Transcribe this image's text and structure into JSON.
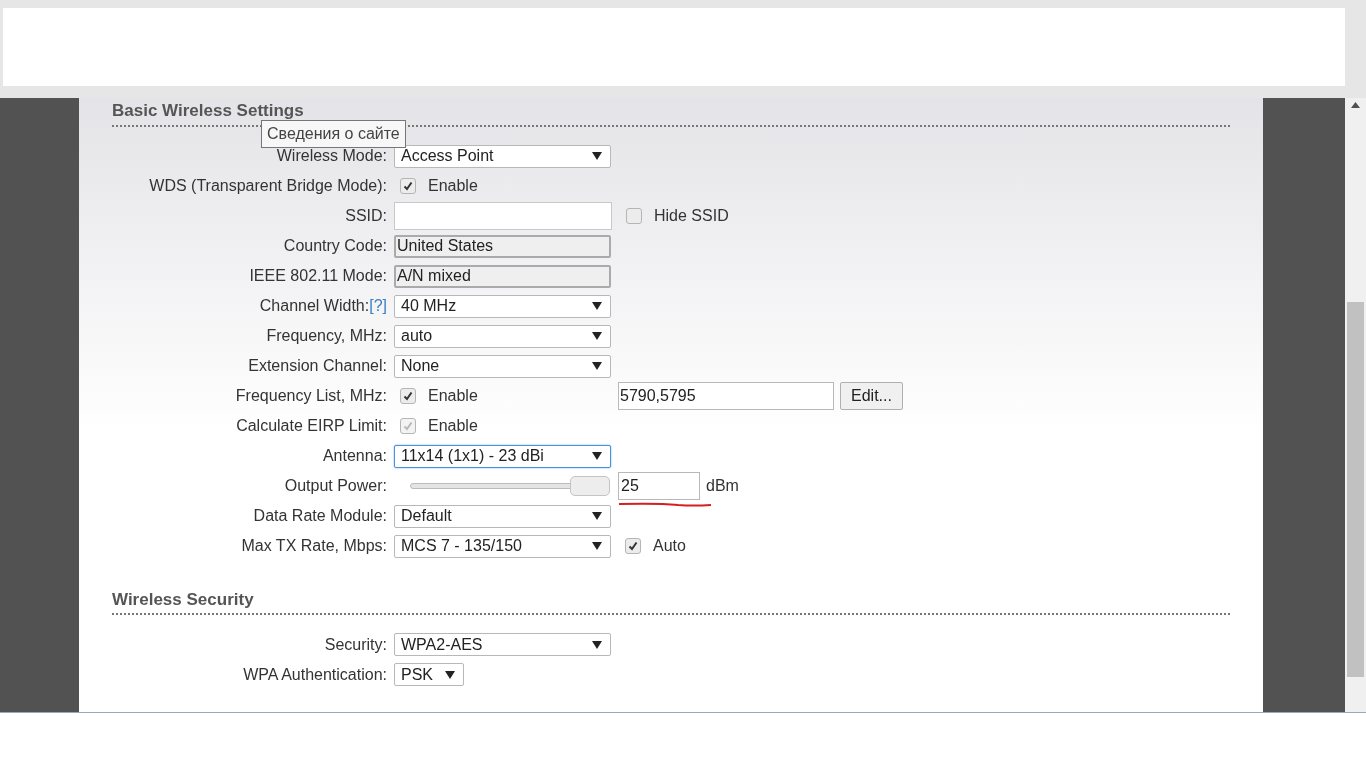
{
  "tooltip": {
    "text": "Сведения о сайте"
  },
  "sections": [
    {
      "title": "Basic Wireless Settings",
      "rows": [
        {
          "kind": "select",
          "label": "Wireless Mode:",
          "value": "Access Point"
        },
        {
          "kind": "checkbox",
          "label": "WDS (Transparent Bridge Mode):",
          "checked": true,
          "disabled": false,
          "text": "Enable"
        },
        {
          "kind": "input",
          "label": "SSID:",
          "side_checkbox": {
            "checked": false,
            "text": "Hide SSID"
          }
        },
        {
          "kind": "readonly",
          "label": "Country Code:",
          "value": "United States"
        },
        {
          "kind": "readonly",
          "label": "IEEE 802.11 Mode:",
          "value": "A/N mixed"
        },
        {
          "kind": "select",
          "label": "Channel Width:",
          "help": "[?]",
          "value": "40 MHz"
        },
        {
          "kind": "select",
          "label": "Frequency, MHz:",
          "value": "auto"
        },
        {
          "kind": "select",
          "label": "Extension Channel:",
          "value": "None"
        },
        {
          "kind": "checkbox",
          "label": "Frequency List, MHz:",
          "checked": true,
          "disabled": false,
          "text": "Enable",
          "side_field": {
            "value": "5790,5795",
            "button": "Edit..."
          }
        },
        {
          "kind": "checkbox",
          "label": "Calculate EIRP Limit:",
          "checked": true,
          "disabled": true,
          "text": "Enable"
        },
        {
          "kind": "select",
          "label": "Antenna:",
          "value": "11x14 (1x1) - 23 dBi",
          "focused": true
        },
        {
          "kind": "slider",
          "label": "Output Power:",
          "level": 1,
          "value": "25",
          "unit": "dBm",
          "underlined": true
        },
        {
          "kind": "select",
          "label": "Data Rate Module:",
          "value": "Default"
        },
        {
          "kind": "select",
          "label": "Max TX Rate, Mbps:",
          "value": "MCS 7 - 135/150",
          "side_checkbox": {
            "checked": true,
            "text": "Auto"
          }
        }
      ]
    },
    {
      "title": "Wireless Security",
      "rows": [
        {
          "kind": "select",
          "label": "Security:",
          "value": "WPA2-AES"
        },
        {
          "kind": "short_select",
          "label": "WPA Authentication:",
          "value": "PSK"
        }
      ]
    }
  ]
}
